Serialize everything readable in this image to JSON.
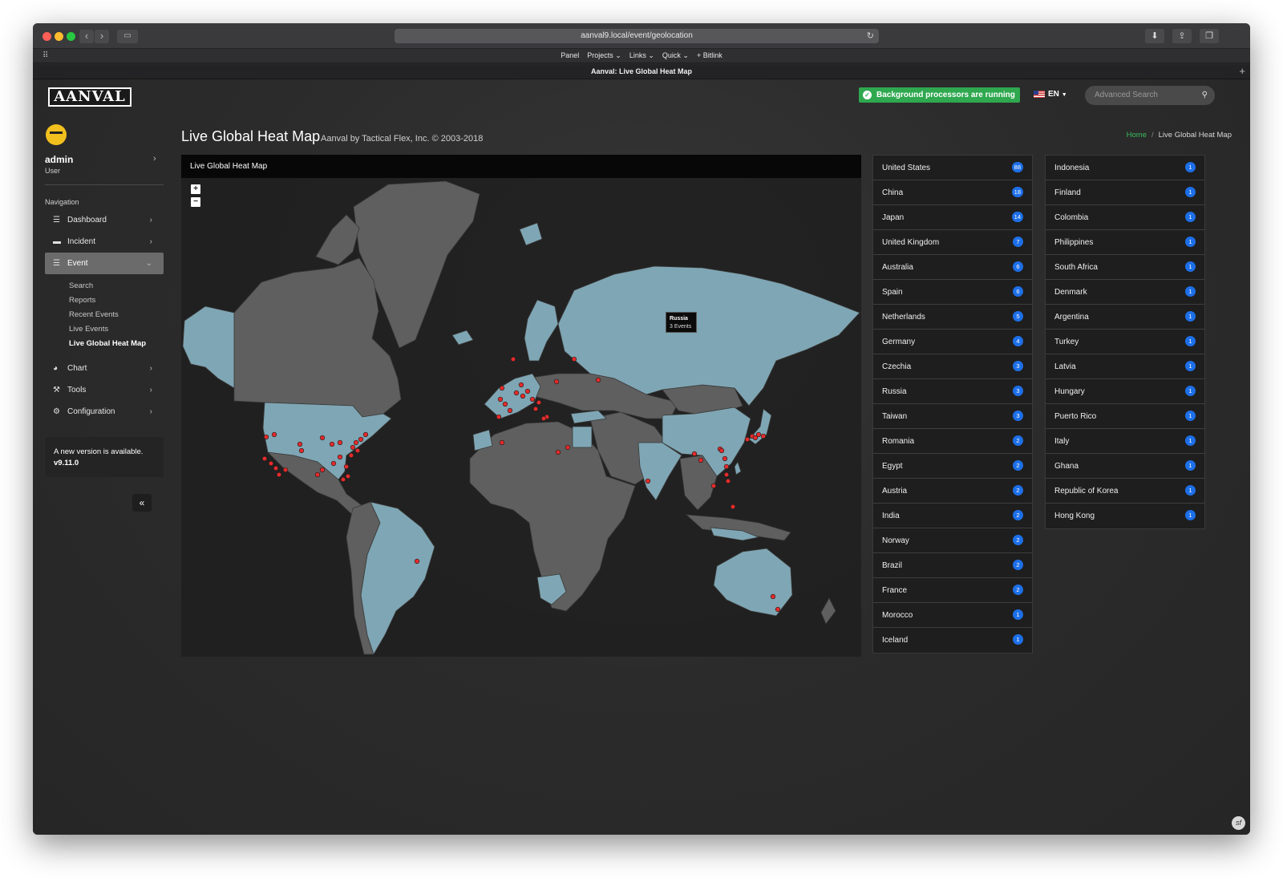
{
  "browser": {
    "url": "aanval9.local/event/geolocation",
    "tab_title": "Aanval: Live Global Heat Map",
    "favorites": [
      "Panel",
      "Projects ⌄",
      "Links ⌄",
      "Quick ⌄",
      "+ Bitlink"
    ]
  },
  "header": {
    "logo_text": "AANVAL",
    "status_text": "Background processors are running",
    "language": "EN",
    "search_placeholder": "Advanced Search"
  },
  "sidebar": {
    "user_name": "admin",
    "user_role": "User",
    "nav_title": "Navigation",
    "items": [
      {
        "label": "Dashboard",
        "icon": "list-icon"
      },
      {
        "label": "Incident",
        "icon": "folder-icon"
      },
      {
        "label": "Event",
        "icon": "list-icon"
      },
      {
        "label": "Chart",
        "icon": "pie-icon"
      },
      {
        "label": "Tools",
        "icon": "wrench-icon"
      },
      {
        "label": "Configuration",
        "icon": "cogs-icon"
      }
    ],
    "event_sub": [
      "Search",
      "Reports",
      "Recent Events",
      "Live Events",
      "Live Global Heat Map"
    ],
    "update_text": "A new version is available.",
    "update_version": "v9.11.0"
  },
  "page": {
    "title": "Live Global Heat Map",
    "subtitle": "Aanval by Tactical Flex, Inc. © 2003-2018",
    "breadcrumb_home": "Home",
    "breadcrumb_current": "Live Global Heat Map"
  },
  "map": {
    "panel_title": "Live Global Heat Map",
    "tooltip_country": "Russia",
    "tooltip_events": "3 Events",
    "colors": {
      "highlight": "#7fa6b4",
      "land": "#5f5f5f",
      "marker": "#e52b2b"
    }
  },
  "countries_left": [
    {
      "name": "United States",
      "count": "88"
    },
    {
      "name": "China",
      "count": "18"
    },
    {
      "name": "Japan",
      "count": "14"
    },
    {
      "name": "United Kingdom",
      "count": "7"
    },
    {
      "name": "Australia",
      "count": "6"
    },
    {
      "name": "Spain",
      "count": "6"
    },
    {
      "name": "Netherlands",
      "count": "5"
    },
    {
      "name": "Germany",
      "count": "4"
    },
    {
      "name": "Czechia",
      "count": "3"
    },
    {
      "name": "Russia",
      "count": "3"
    },
    {
      "name": "Taiwan",
      "count": "3"
    },
    {
      "name": "Romania",
      "count": "2"
    },
    {
      "name": "Egypt",
      "count": "2"
    },
    {
      "name": "Austria",
      "count": "2"
    },
    {
      "name": "India",
      "count": "2"
    },
    {
      "name": "Norway",
      "count": "2"
    },
    {
      "name": "Brazil",
      "count": "2"
    },
    {
      "name": "France",
      "count": "2"
    },
    {
      "name": "Morocco",
      "count": "1"
    },
    {
      "name": "Iceland",
      "count": "1"
    }
  ],
  "countries_right": [
    {
      "name": "Indonesia",
      "count": "1"
    },
    {
      "name": "Finland",
      "count": "1"
    },
    {
      "name": "Colombia",
      "count": "1"
    },
    {
      "name": "Philippines",
      "count": "1"
    },
    {
      "name": "South Africa",
      "count": "1"
    },
    {
      "name": "Denmark",
      "count": "1"
    },
    {
      "name": "Argentina",
      "count": "1"
    },
    {
      "name": "Turkey",
      "count": "1"
    },
    {
      "name": "Latvia",
      "count": "1"
    },
    {
      "name": "Hungary",
      "count": "1"
    },
    {
      "name": "Puerto Rico",
      "count": "1"
    },
    {
      "name": "Italy",
      "count": "1"
    },
    {
      "name": "Ghana",
      "count": "1"
    },
    {
      "name": "Republic of Korea",
      "count": "1"
    },
    {
      "name": "Hong Kong",
      "count": "1"
    }
  ]
}
